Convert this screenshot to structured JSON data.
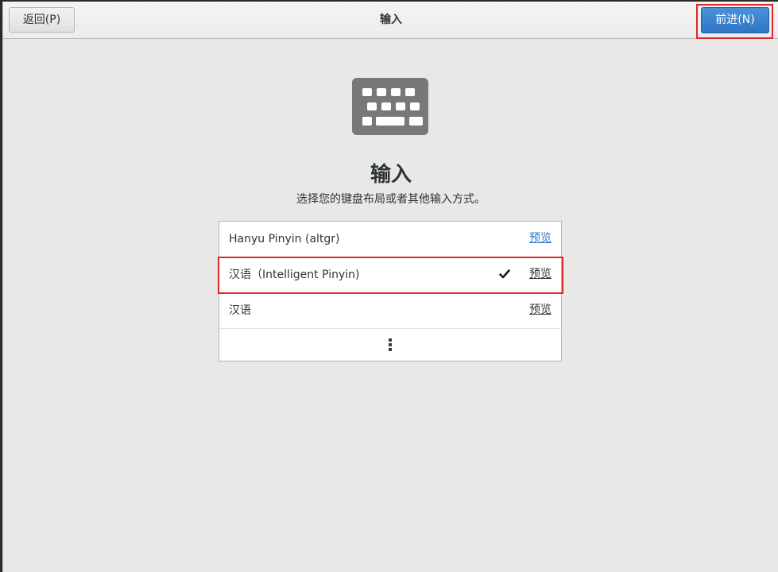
{
  "header": {
    "back_label": "返回(P)",
    "title": "输入",
    "next_label": "前进(N)"
  },
  "main": {
    "icon": "keyboard-icon",
    "title": "输入",
    "subtitle": "选择您的键盘布局或者其他输入方式。"
  },
  "layouts": {
    "items": [
      {
        "label": "Hanyu Pinyin (altgr)",
        "preview_label": "预览",
        "selected": false
      },
      {
        "label": "汉语（Intelligent Pinyin)",
        "preview_label": "预览",
        "selected": true
      },
      {
        "label": "汉语",
        "preview_label": "预览",
        "selected": false
      }
    ],
    "more_icon": "more-vertical-icon"
  },
  "colors": {
    "accent": "#3584e4",
    "highlight": "#e0262d",
    "link": "#2a76c6",
    "background": "#e8e8e7"
  }
}
